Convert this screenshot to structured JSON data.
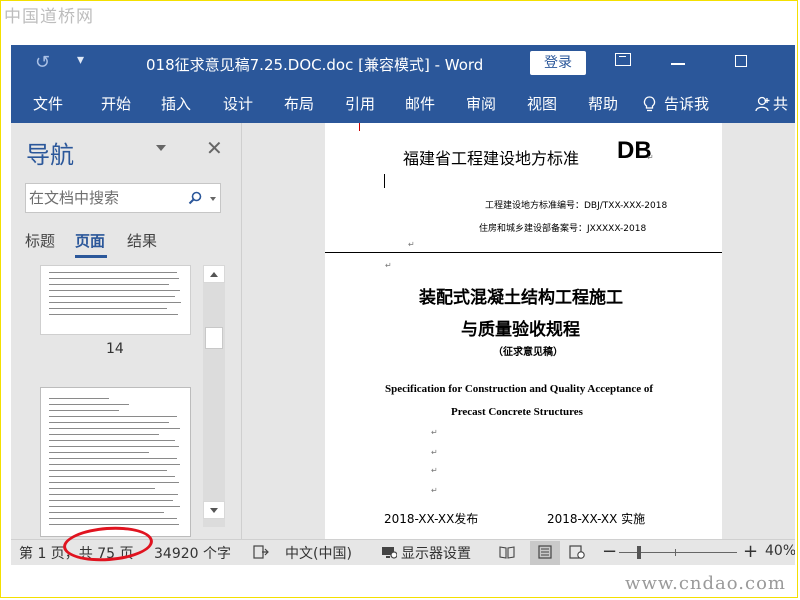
{
  "watermark": {
    "top": "中国道桥网",
    "bottom": "www.cndao.com"
  },
  "titlebar": {
    "title": "018征求意见稿7.25.DOC.doc [兼容模式]  -  Word",
    "login": "登录"
  },
  "ribbon": {
    "tabs": [
      "文件",
      "开始",
      "插入",
      "设计",
      "布局",
      "引用",
      "邮件",
      "审阅",
      "视图",
      "帮助"
    ],
    "tell_me": "告诉我",
    "share": "共"
  },
  "nav": {
    "title": "导航",
    "search_placeholder": "在文档中搜索",
    "tabs": [
      "标题",
      "页面",
      "结果"
    ],
    "thumb_page_number": "14"
  },
  "page": {
    "header_left": "福建省工程建设地方标准",
    "header_db": "DB",
    "std_number": "工程建设地方标准编号：DBJ/TXX-XXX-2018",
    "record_number": "住房和城乡建设部备案号：JXXXXX-2018",
    "title_line1": "装配式混凝土结构工程施工",
    "title_line2": "与质量验收规程",
    "subtitle": "（征求意见稿）",
    "english_line1": "Specification for Construction and Quality Acceptance of",
    "english_line2": "Precast Concrete Structures",
    "issue_date": "2018-XX-XX发布",
    "effective_date": "2018-XX-XX  实施"
  },
  "status": {
    "page": "第 1 页，共 75 页",
    "words": "34920 个字",
    "language": "中文(中国)",
    "display_settings": "显示器设置",
    "zoom_minus": "−",
    "zoom_plus": "+",
    "zoom": "40%"
  },
  "colors": {
    "accent": "#2b579a",
    "highlight_circle": "#e0131f"
  }
}
